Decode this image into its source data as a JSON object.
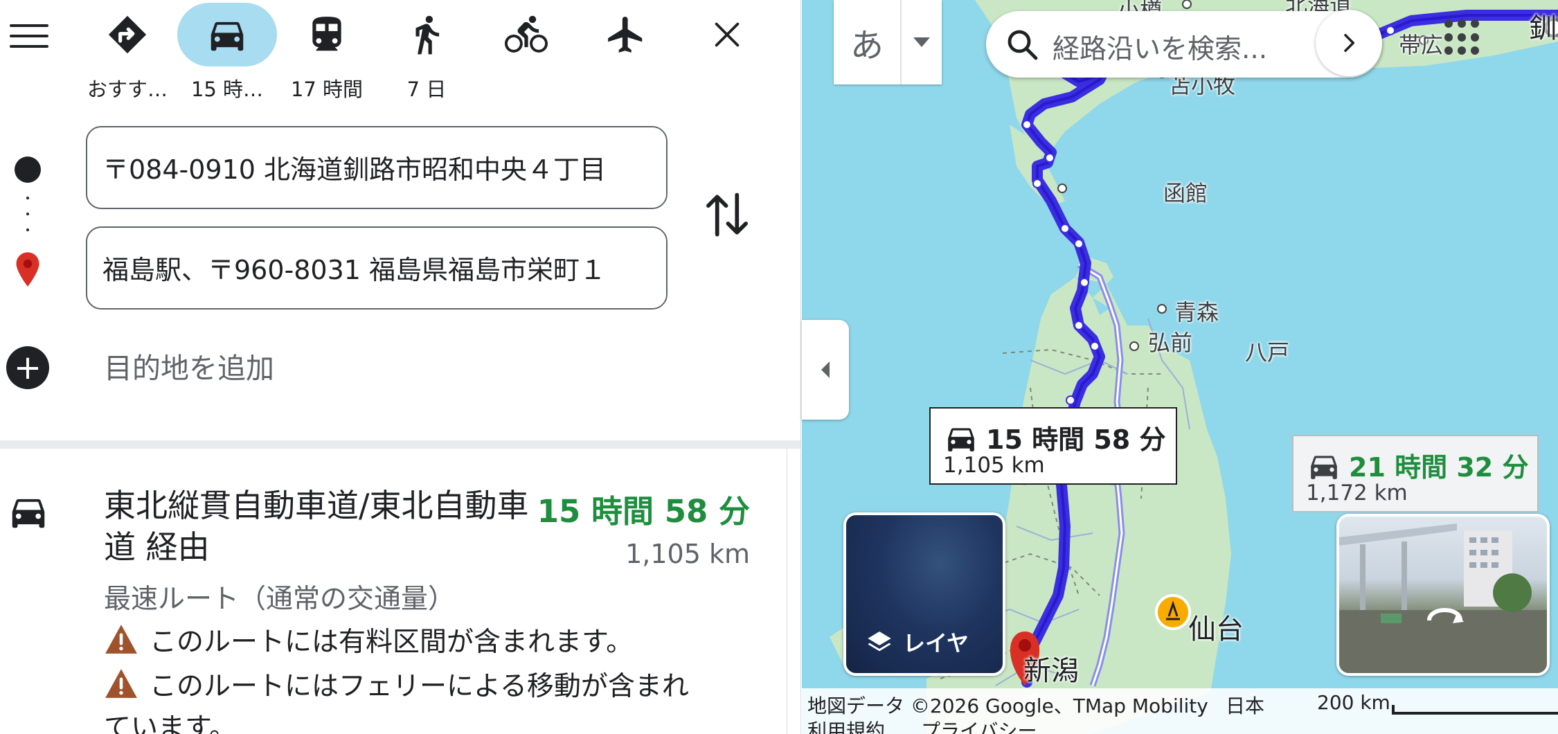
{
  "travel_modes": [
    {
      "name": "best",
      "label": "おすす…",
      "active": false
    },
    {
      "name": "driving",
      "label": "15 時…",
      "active": true
    },
    {
      "name": "transit",
      "label": "17 時間",
      "active": false
    },
    {
      "name": "walking",
      "label": "7 日",
      "active": false
    },
    {
      "name": "cycling",
      "label": "",
      "active": false
    },
    {
      "name": "flights",
      "label": "",
      "active": false
    }
  ],
  "directions": {
    "origin_value": "〒084-0910 北海道釧路市昭和中央４丁目",
    "destination_value": "福島駅、〒960-8031 福島県福島市栄町１",
    "add_destination": "目的地を追加"
  },
  "route": {
    "name": "東北縦貫自動車道/東北自動車道 経由",
    "time": "15 時間 58 分",
    "distance": "1,105 km",
    "subtitle": "最速ルート（通常の交通量）",
    "warnings": [
      "このルートには有料区間が含まれます。",
      "このルートにはフェリーによる移動が含まれ"
    ],
    "warning_continued": "ています。"
  },
  "map": {
    "ime_char": "あ",
    "search_placeholder": "経路沿いを検索...",
    "primary_bubble": {
      "time": "15 時間 58 分",
      "distance": "1,105 km"
    },
    "alt_bubble": {
      "time": "21 時間 32 分",
      "distance": "1,172 km"
    },
    "layers_label": "レイヤ",
    "place_labels": {
      "otaru": "小樽",
      "hokkaido": "北海道",
      "obihiro": "帯広",
      "kushiro": "釧路",
      "tomakomai": "苫小牧",
      "hakodate": "函館",
      "aomori": "青森",
      "hirosaki": "弘前",
      "hachinohe": "八戸",
      "sendai": "仙台",
      "niigata": "新潟"
    },
    "attribution": "地図データ ©2026 Google、TMap Mobility",
    "country": "日本",
    "scale": "200 km",
    "terms": "利用規約",
    "privacy": "プライバシー"
  },
  "colors": {
    "route_primary": "#3b2ee0",
    "route_alt": "#8a8fe8",
    "time_green": "#1e8e3e",
    "active_mode_bg": "#a8dcf0",
    "water": "#8fd7ea",
    "land": "#c9e7c4"
  }
}
